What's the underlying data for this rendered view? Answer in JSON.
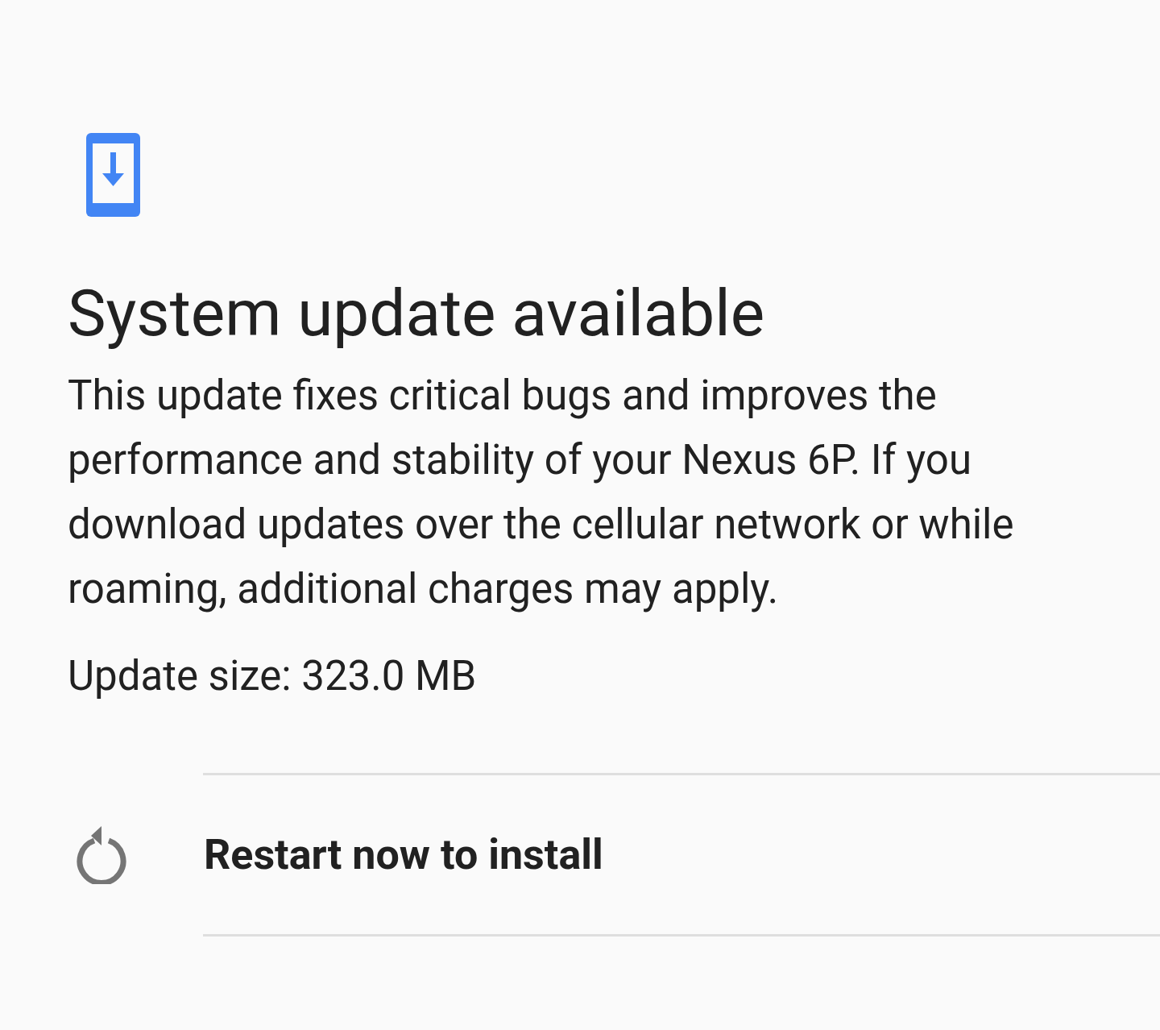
{
  "title": "System update available",
  "description": "This update fixes critical bugs and improves the performance and stability of your Nexus 6P. If you download updates over the cellular network or while roaming, additional charges may apply.",
  "update_size": "Update size: 323.0 MB",
  "action": {
    "label": "Restart now to install"
  }
}
